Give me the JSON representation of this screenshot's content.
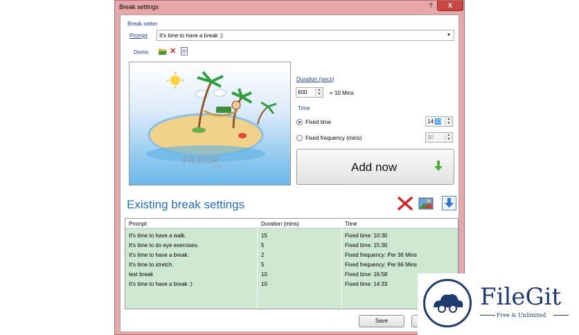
{
  "window": {
    "title": "Break settings",
    "help_glyph": "?",
    "close_glyph": "X"
  },
  "setter": {
    "group_label": "Break setter",
    "prompt_label": "Prompt",
    "prompt_value": "It's time to have a break :)",
    "demo_label": "Demo"
  },
  "duration": {
    "label": "Duration (secs)",
    "value": "600",
    "equals_text": "= 10 Mins"
  },
  "time": {
    "label": "Time",
    "fixed_time_label": "Fixed time",
    "fixed_time_value": "14:33",
    "fixed_time_hour": "14:",
    "fixed_time_min": "33",
    "fixed_freq_label": "Fixed frequency (mins)",
    "fixed_freq_value": "30"
  },
  "add_button": {
    "label": "Add now"
  },
  "existing": {
    "heading": "Existing break settings",
    "columns": [
      "Prompt",
      "Duration (mins)",
      "Time"
    ],
    "rows": [
      {
        "prompt": "It's time to have a walk.",
        "duration": "15",
        "time": "Fixed time: 10:30"
      },
      {
        "prompt": "It's time to do eye exercises.",
        "duration": "5",
        "time": "Fixed time: 15:30"
      },
      {
        "prompt": "It's time to have a break.",
        "duration": "2",
        "time": "Fixed frequency: Per 36 Mins"
      },
      {
        "prompt": "It's time to stretch.",
        "duration": "5",
        "time": "Fixed frequency: Per 66 Mins"
      },
      {
        "prompt": "test break",
        "duration": "10",
        "time": "Fixed time: 16:58"
      },
      {
        "prompt": "It's time to have a break :)",
        "duration": "10",
        "time": "Fixed time: 14:33"
      }
    ]
  },
  "footer": {
    "save_label": "Save"
  },
  "watermark": {
    "text": "FILECR",
    "sub": ".com"
  },
  "filegit": {
    "name": "FileGit",
    "tagline": "Free & Unlimited"
  },
  "colors": {
    "frame": "#e7a7a9",
    "accent": "#1e6ec2",
    "table_bg": "#cfe8d2",
    "close": "#c94643"
  }
}
